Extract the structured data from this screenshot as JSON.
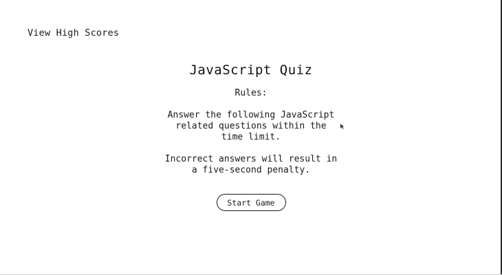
{
  "header": {
    "high_scores_label": "View High Scores"
  },
  "quiz": {
    "title": "JavaScript Quiz",
    "rules_heading": "Rules:",
    "rules": [
      "Answer the following JavaScript related questions within the time limit.",
      "Incorrect answers will result in a five-second penalty."
    ],
    "start_button_label": "Start Game"
  },
  "icons": {
    "cursor": "mouse-pointer-icon"
  },
  "colors": {
    "background": "#ffffff",
    "text": "#1a1a1a",
    "button_border": "#1a1a1a"
  }
}
